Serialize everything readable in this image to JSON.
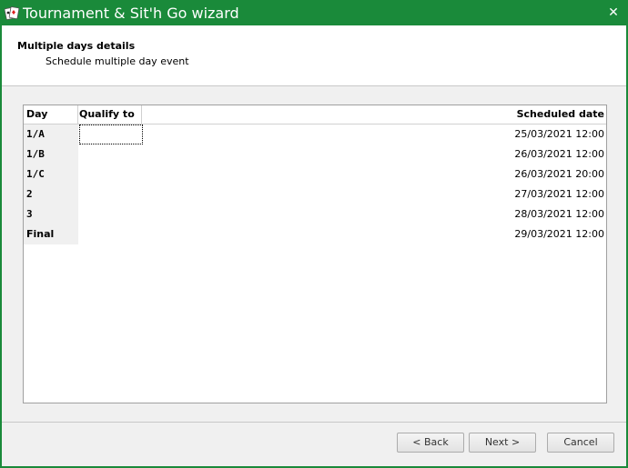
{
  "window": {
    "title": "Tournament & Sit'h Go wizard",
    "close_glyph": "✕",
    "accent_color": "#1a8a3a"
  },
  "header": {
    "title": "Multiple days details",
    "subtitle": "Schedule multiple day event"
  },
  "grid": {
    "columns": {
      "day": "Day",
      "qualify": "Qualify to",
      "scheduled": "Scheduled date"
    },
    "rows": [
      {
        "day": "1/A",
        "qualify": "",
        "scheduled": "25/03/2021 12:00"
      },
      {
        "day": "1/B",
        "qualify": "",
        "scheduled": "26/03/2021 12:00"
      },
      {
        "day": "1/C",
        "qualify": "",
        "scheduled": "26/03/2021 20:00"
      },
      {
        "day": "2",
        "qualify": "",
        "scheduled": "27/03/2021 12:00"
      },
      {
        "day": "3",
        "qualify": "",
        "scheduled": "28/03/2021 12:00"
      },
      {
        "day": "Final",
        "qualify": "",
        "scheduled": "29/03/2021 12:00"
      }
    ]
  },
  "buttons": {
    "back": "< Back",
    "next": "Next >",
    "cancel": "Cancel"
  }
}
